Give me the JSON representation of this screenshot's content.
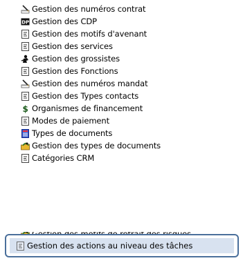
{
  "menu": {
    "items": [
      {
        "label": "Gestion des numéros contrat",
        "icon": "pen-paper-icon"
      },
      {
        "label": "Gestion des CDP",
        "icon": "dp-badge-icon"
      },
      {
        "label": "Gestion des motifs d'avenant",
        "icon": "form-document-icon"
      },
      {
        "label": "Gestion des services",
        "icon": "form-document-icon"
      },
      {
        "label": "Gestion des grossistes",
        "icon": "person-silhouette-icon"
      },
      {
        "label": "Gestion des Fonctions",
        "icon": "form-document-icon"
      },
      {
        "label": "Gestion des numéros mandat",
        "icon": "pen-paper-icon"
      },
      {
        "label": "Gestion des Types contacts",
        "icon": "form-document-icon"
      },
      {
        "label": "Organismes de financement",
        "icon": "dollar-icon"
      },
      {
        "label": "Modes de paiement",
        "icon": "form-document-icon"
      },
      {
        "label": "Types de documents",
        "icon": "blue-document-icon"
      },
      {
        "label": "Gestion des types de documents",
        "icon": "folder-swirl-icon"
      },
      {
        "label": "Catégories CRM",
        "icon": "form-document-icon"
      },
      {
        "label": "Gestion des motifs de retrait des risques",
        "icon": "folder-swirl-icon"
      }
    ],
    "selected": {
      "label": "Gestion des actions au niveau des tâches",
      "icon": "form-document-icon"
    }
  },
  "colors": {
    "selection_border": "#4a6f9b",
    "selection_fill": "#c9d7ea"
  }
}
